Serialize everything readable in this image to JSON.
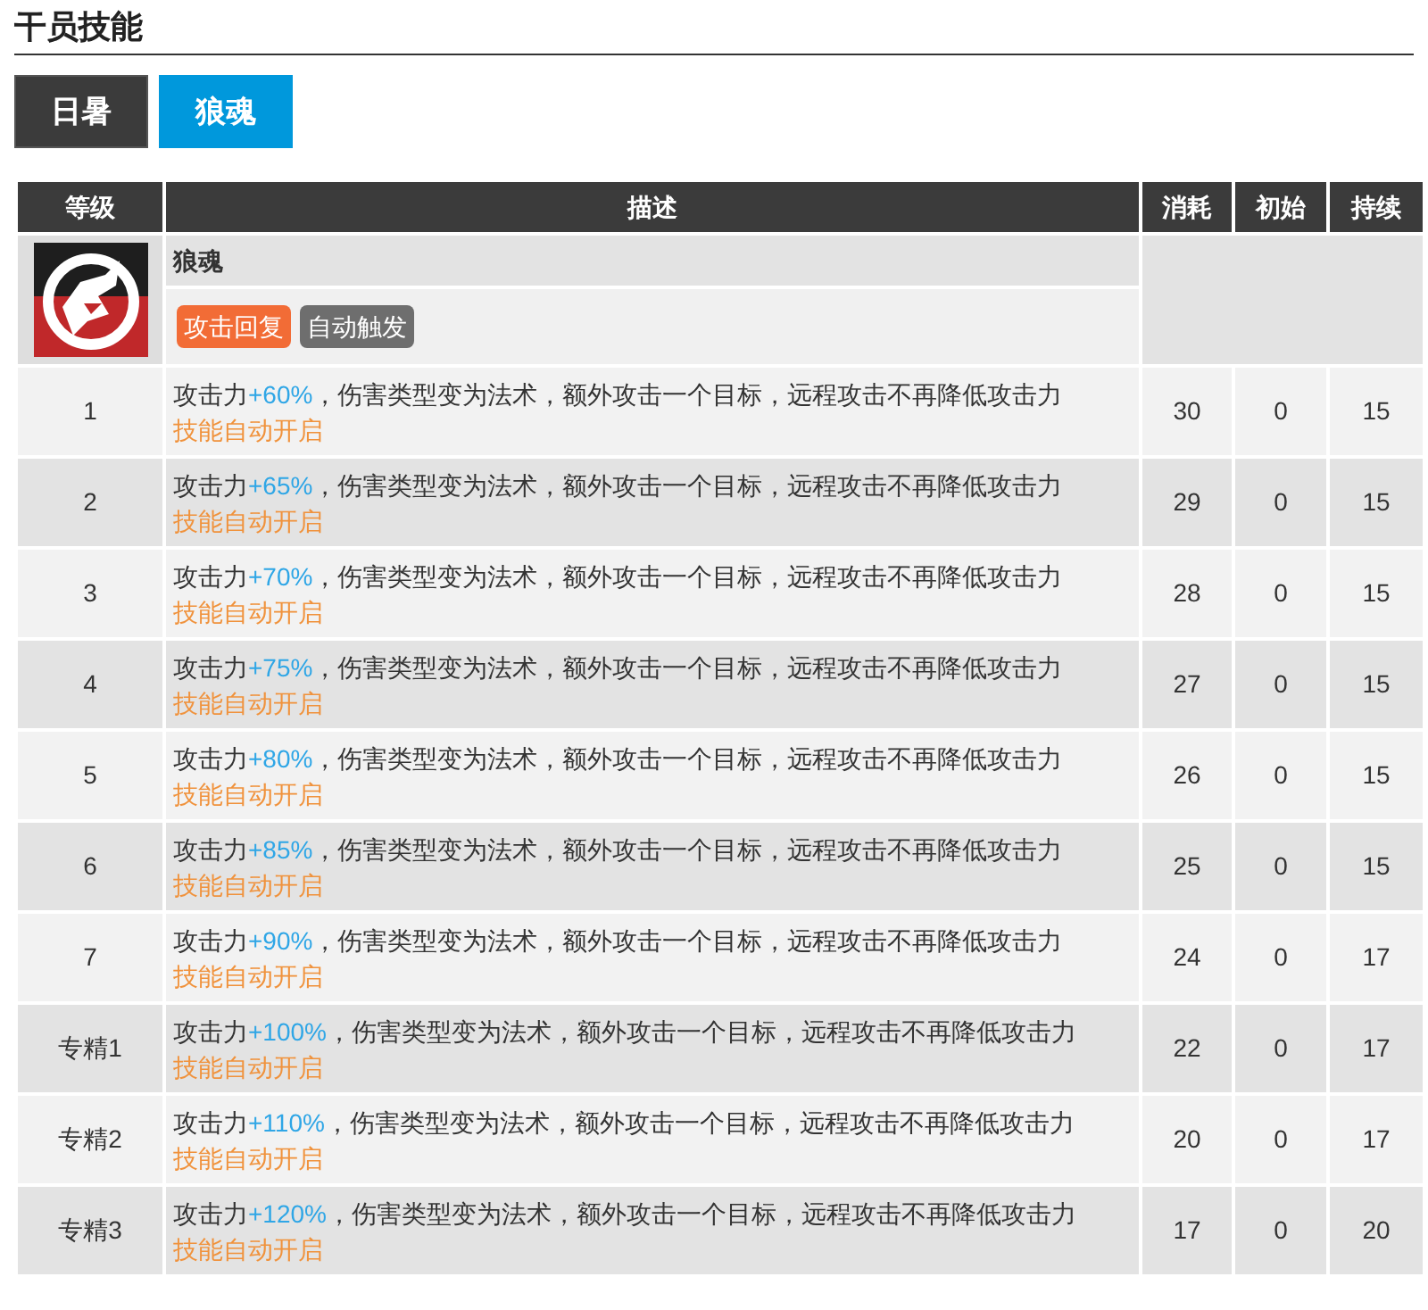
{
  "section_title": "干员技能",
  "tabs": [
    {
      "label": "日暑",
      "selected": false
    },
    {
      "label": "狼魂",
      "selected": true
    }
  ],
  "skill": {
    "name": "狼魂",
    "tags": [
      {
        "label": "攻击回复",
        "color": "#f26c36"
      },
      {
        "label": "自动触发",
        "color": "#6e6e6e"
      }
    ]
  },
  "table": {
    "columns": [
      "等级",
      "描述",
      "消耗",
      "初始",
      "持续"
    ],
    "rows": [
      {
        "level": "1",
        "stat": "攻击力",
        "bonus": "+60%",
        "effect": "，伤害类型变为法术，额外攻击一个目标，远程攻击不再降低攻击力",
        "note": "技能自动开启",
        "cost": "30",
        "initial": "0",
        "duration": "15"
      },
      {
        "level": "2",
        "stat": "攻击力",
        "bonus": "+65%",
        "effect": "，伤害类型变为法术，额外攻击一个目标，远程攻击不再降低攻击力",
        "note": "技能自动开启",
        "cost": "29",
        "initial": "0",
        "duration": "15"
      },
      {
        "level": "3",
        "stat": "攻击力",
        "bonus": "+70%",
        "effect": "，伤害类型变为法术，额外攻击一个目标，远程攻击不再降低攻击力",
        "note": "技能自动开启",
        "cost": "28",
        "initial": "0",
        "duration": "15"
      },
      {
        "level": "4",
        "stat": "攻击力",
        "bonus": "+75%",
        "effect": "，伤害类型变为法术，额外攻击一个目标，远程攻击不再降低攻击力",
        "note": "技能自动开启",
        "cost": "27",
        "initial": "0",
        "duration": "15"
      },
      {
        "level": "5",
        "stat": "攻击力",
        "bonus": "+80%",
        "effect": "，伤害类型变为法术，额外攻击一个目标，远程攻击不再降低攻击力",
        "note": "技能自动开启",
        "cost": "26",
        "initial": "0",
        "duration": "15"
      },
      {
        "level": "6",
        "stat": "攻击力",
        "bonus": "+85%",
        "effect": "，伤害类型变为法术，额外攻击一个目标，远程攻击不再降低攻击力",
        "note": "技能自动开启",
        "cost": "25",
        "initial": "0",
        "duration": "15"
      },
      {
        "level": "7",
        "stat": "攻击力",
        "bonus": "+90%",
        "effect": "，伤害类型变为法术，额外攻击一个目标，远程攻击不再降低攻击力",
        "note": "技能自动开启",
        "cost": "24",
        "initial": "0",
        "duration": "17"
      },
      {
        "level": "专精1",
        "stat": "攻击力",
        "bonus": "+100%",
        "effect": "，伤害类型变为法术，额外攻击一个目标，远程攻击不再降低攻击力",
        "note": "技能自动开启",
        "cost": "22",
        "initial": "0",
        "duration": "17"
      },
      {
        "level": "专精2",
        "stat": "攻击力",
        "bonus": "+110%",
        "effect": "，伤害类型变为法术，额外攻击一个目标，远程攻击不再降低攻击力",
        "note": "技能自动开启",
        "cost": "20",
        "initial": "0",
        "duration": "17"
      },
      {
        "level": "专精3",
        "stat": "攻击力",
        "bonus": "+120%",
        "effect": "，伤害类型变为法术，额外攻击一个目标，远程攻击不再降低攻击力",
        "note": "技能自动开启",
        "cost": "17",
        "initial": "0",
        "duration": "20"
      }
    ]
  }
}
